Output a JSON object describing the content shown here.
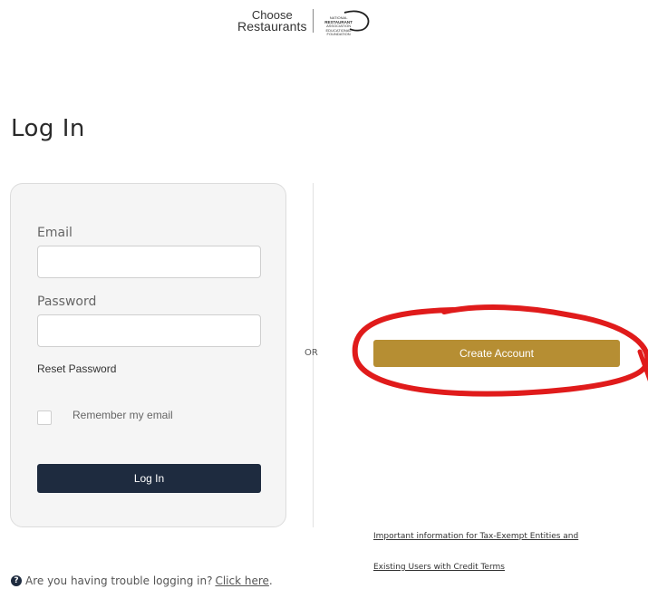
{
  "header": {
    "logo_line1": "Choose",
    "logo_line2": "Restaurants",
    "partner_line1": "NATIONAL",
    "partner_line2": "RESTAURANT",
    "partner_line3": "ASSOCIATION",
    "partner_line4": "EDUCATIONAL FOUNDATION"
  },
  "page": {
    "title": "Log In"
  },
  "login_form": {
    "email_label": "Email",
    "email_value": "",
    "password_label": "Password",
    "password_value": "",
    "reset_password": "Reset Password",
    "remember_label": "Remember my email",
    "remember_checked": false,
    "login_button": "Log In"
  },
  "divider": {
    "or_text": "OR"
  },
  "create_account": {
    "button_label": "Create Account",
    "annotation_color": "#e01b1b"
  },
  "info_links": [
    {
      "text": "Important information for Tax-Exempt Entities and"
    },
    {
      "text": "Existing Users with Credit Terms"
    }
  ],
  "help": {
    "icon": "question-circle-icon",
    "text": "Are you having trouble logging in?",
    "link": "Click here",
    "suffix": "."
  },
  "colors": {
    "primary_button": "#1e2b3f",
    "accent_button": "#b68e33"
  }
}
